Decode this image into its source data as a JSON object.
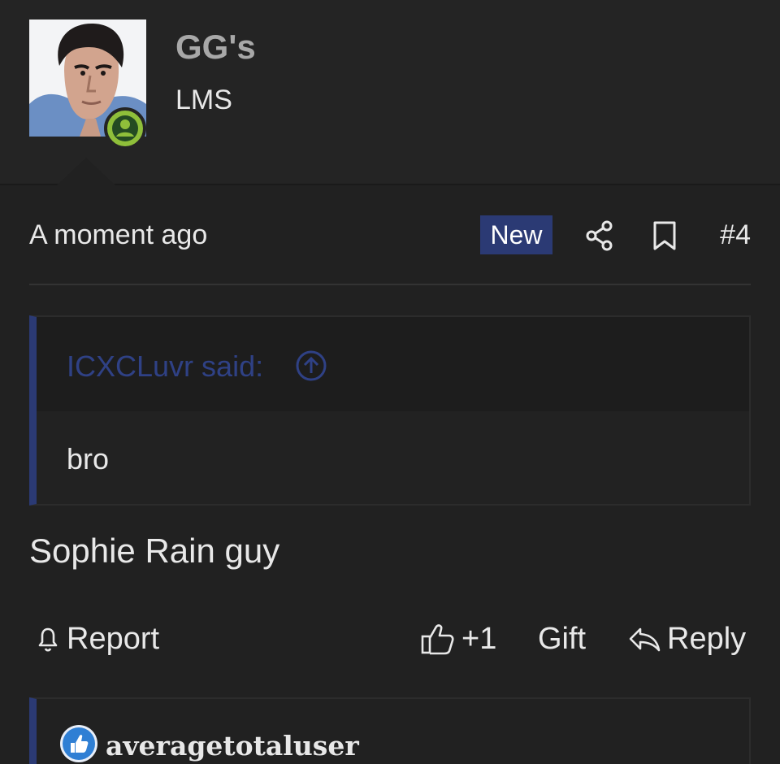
{
  "user": {
    "name": "GG's",
    "title": "LMS"
  },
  "post": {
    "timestamp": "A moment ago",
    "new_label": "New",
    "number": "#4",
    "body": "Sophie Rain guy"
  },
  "quote": {
    "author_line": "ICXCLuvr said:",
    "text": "bro"
  },
  "actions": {
    "report": "Report",
    "like": "+1",
    "gift": "Gift",
    "reply": "Reply"
  },
  "reaction": {
    "user": "averagetotaluser"
  },
  "colors": {
    "background": "#212121",
    "accent_blue": "#2b3a74",
    "online_green": "#8fbf3a",
    "muted_name": "#a8a8a8"
  },
  "icons": [
    "user-online-icon",
    "share-icon",
    "bookmark-icon",
    "arrow-up-circle-icon",
    "bell-icon",
    "thumbs-up-icon",
    "reply-arrow-icon",
    "like-badge-icon"
  ]
}
